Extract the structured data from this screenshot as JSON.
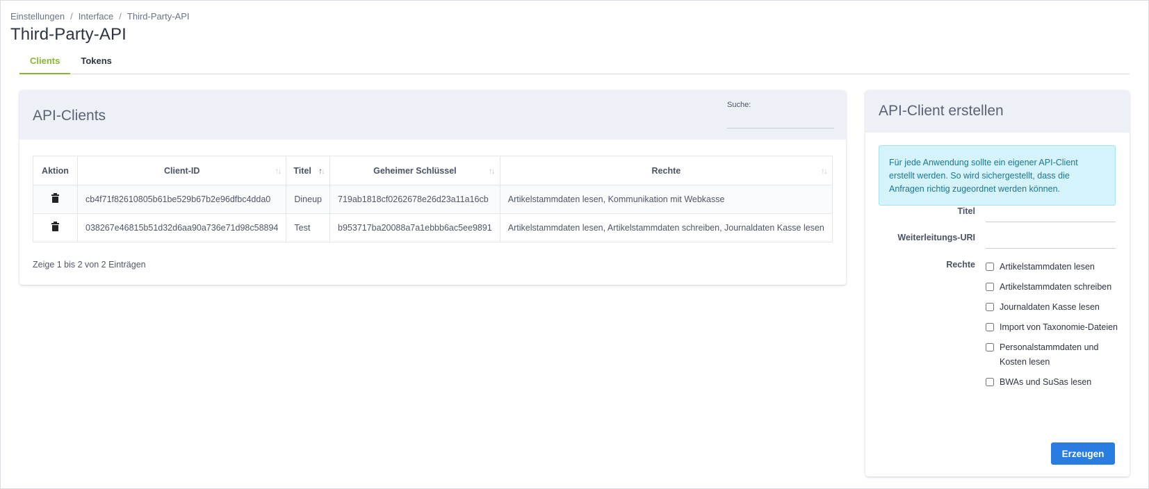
{
  "breadcrumb": [
    "Einstellungen",
    "Interface",
    "Third-Party-API"
  ],
  "page": {
    "title": "Third-Party-API"
  },
  "tabs": [
    {
      "label": "Clients",
      "active": true
    },
    {
      "label": "Tokens",
      "active": false
    }
  ],
  "clients_panel": {
    "title": "API-Clients",
    "search_label": "Suche:",
    "search_value": "",
    "columns": [
      "Aktion",
      "Client-ID",
      "Titel",
      "Geheimer Schlüssel",
      "Rechte"
    ],
    "rows": [
      {
        "client_id": "cb4f71f82610805b61be529b67b2e96dfbc4dda0",
        "titel": "Dineup",
        "secret": "719ab1818cf0262678e26d23a11a16cb",
        "rechte": "Artikelstammdaten lesen, Kommunikation mit Webkasse"
      },
      {
        "client_id": "038267e46815b51d32d6aa90a736e71d98c58894",
        "titel": "Test",
        "secret": "b953717ba20088a7a1ebbb6ac5ee9891",
        "rechte": "Artikelstammdaten lesen, Artikelstammdaten schreiben, Journaldaten Kasse lesen"
      }
    ],
    "info": "Zeige 1 bis 2 von 2 Einträgen",
    "sort_icon": "sort-arrows-icon",
    "delete_icon": "trash-icon"
  },
  "create_panel": {
    "title": "API-Client erstellen",
    "alert": "Für jede Anwendung sollte ein eigener API-Client erstellt werden. So wird sichergestellt, dass die Anfragen richtig zugeordnet werden können.",
    "title_label": "Titel",
    "title_value": "",
    "uri_label": "Weiterleitungs-URI",
    "uri_value": "",
    "rights_label": "Rechte",
    "rights": [
      "Artikelstammdaten lesen",
      "Artikelstammdaten schreiben",
      "Journaldaten Kasse lesen",
      "Import von Taxonomie-Dateien",
      "Personalstammdaten und Kosten lesen",
      "BWAs und SuSas lesen"
    ],
    "submit": "Erzeugen"
  },
  "colors": {
    "accent_tab": "#8bb530",
    "button": "#2a7de0",
    "panel_header": "#edf1f7",
    "alert_bg": "#d4f3fb"
  }
}
